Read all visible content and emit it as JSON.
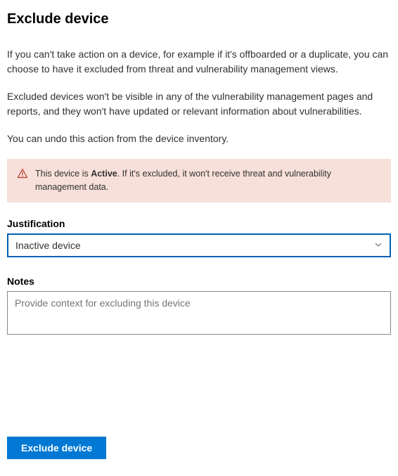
{
  "title": "Exclude device",
  "description": {
    "p1": "If you can't take action on a device, for example if it's offboarded or a duplicate, you can choose to have it excluded from threat and vulnerability management views.",
    "p2": "Excluded devices won't be visible in any of the vulnerability management pages and reports, and they won't have updated or relevant information about vulnerabilities.",
    "p3": "You can undo this action from the device inventory."
  },
  "alert": {
    "prefix": "This device is ",
    "status": "Active",
    "suffix": ". If it's excluded, it won't receive threat and vulnerability management data."
  },
  "justification": {
    "label": "Justification",
    "selected": "Inactive device"
  },
  "notes": {
    "label": "Notes",
    "placeholder": "Provide context for excluding this device"
  },
  "submit": {
    "label": "Exclude device"
  }
}
